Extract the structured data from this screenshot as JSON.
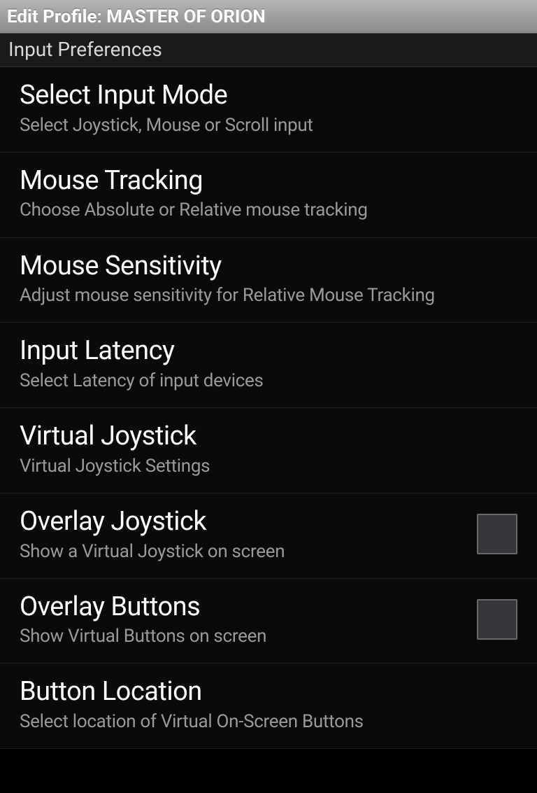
{
  "header": {
    "title": "Edit Profile: MASTER OF ORION"
  },
  "section": {
    "label": "Input Preferences"
  },
  "prefs": {
    "selectInputMode": {
      "title": "Select Input Mode",
      "desc": "Select Joystick, Mouse or Scroll input"
    },
    "mouseTracking": {
      "title": "Mouse Tracking",
      "desc": "Choose Absolute or Relative mouse tracking"
    },
    "mouseSensitivity": {
      "title": "Mouse Sensitivity",
      "desc": "Adjust mouse sensitivity for Relative Mouse Tracking"
    },
    "inputLatency": {
      "title": "Input Latency",
      "desc": "Select Latency of input devices"
    },
    "virtualJoystick": {
      "title": "Virtual Joystick",
      "desc": "Virtual Joystick Settings"
    },
    "overlayJoystick": {
      "title": "Overlay Joystick",
      "desc": "Show a Virtual Joystick on screen",
      "checked": false
    },
    "overlayButtons": {
      "title": "Overlay Buttons",
      "desc": "Show Virtual Buttons on screen",
      "checked": false
    },
    "buttonLocation": {
      "title": "Button Location",
      "desc": "Select location of Virtual On-Screen Buttons"
    }
  }
}
